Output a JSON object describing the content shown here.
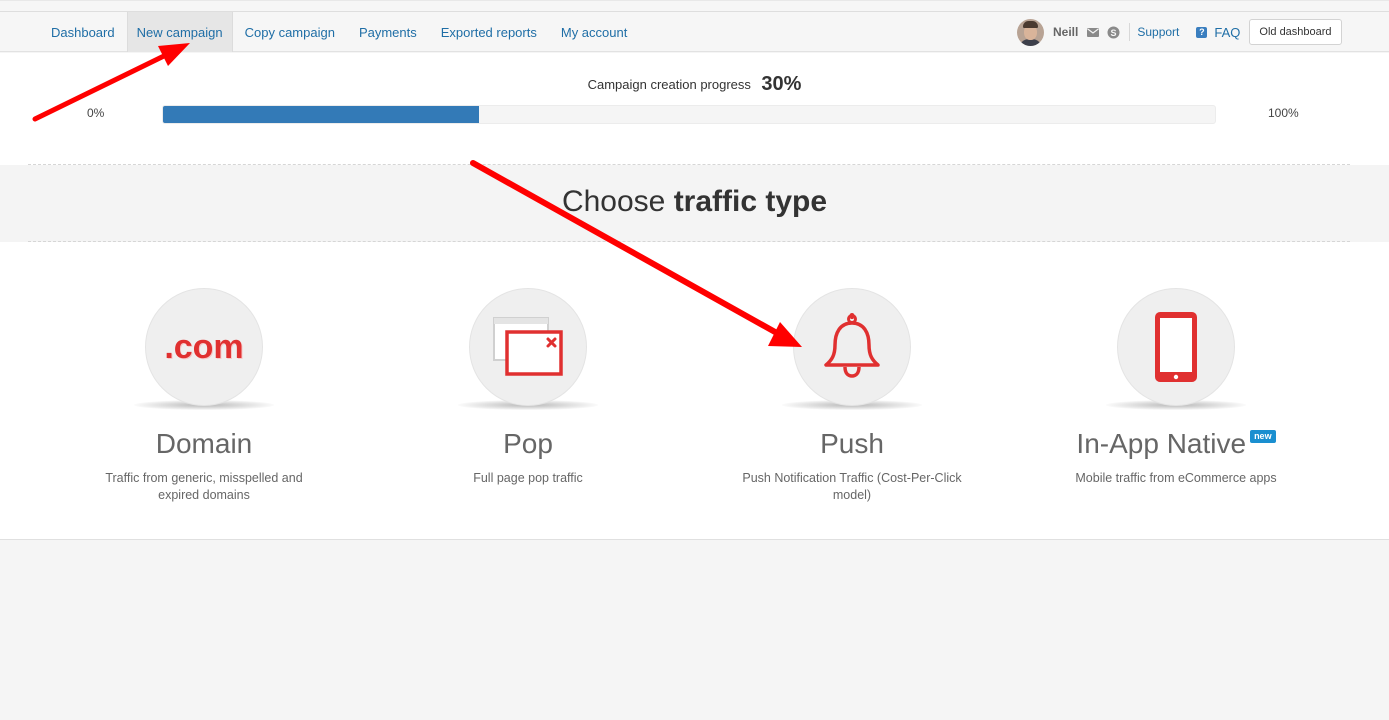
{
  "nav": {
    "items": [
      {
        "label": "Dashboard"
      },
      {
        "label": "New campaign"
      },
      {
        "label": "Copy campaign"
      },
      {
        "label": "Payments"
      },
      {
        "label": "Exported reports"
      },
      {
        "label": "My account"
      }
    ],
    "active_index": 1
  },
  "user": {
    "name": "Neill",
    "support_label": "Support",
    "faq_label": "FAQ",
    "faq_icon_glyph": "?",
    "old_dashboard_label": "Old dashboard"
  },
  "progress": {
    "label": "Campaign creation progress",
    "value_text": "30%",
    "value": 30,
    "min_label": "0%",
    "max_label": "100%"
  },
  "heading": {
    "normal": "Choose ",
    "bold": "traffic type"
  },
  "traffic_types": [
    {
      "title": "Domain",
      "description": "Traffic from generic, misspelled and expired domains",
      "icon": "domain-com-icon",
      "icon_text": ".com"
    },
    {
      "title": "Pop",
      "description": "Full page pop traffic",
      "icon": "popup-window-icon"
    },
    {
      "title": "Push",
      "description": "Push Notification Traffic (Cost-Per-Click model)",
      "icon": "bell-icon"
    },
    {
      "title": "In-App Native",
      "description": "Mobile traffic from eCommerce apps",
      "icon": "mobile-phone-icon",
      "badge": "new"
    }
  ],
  "colors": {
    "link": "#1f6ea6",
    "progress_fill": "#337ab7",
    "icon_red": "#e03030",
    "badge_blue": "#1a8fd0",
    "annotation_arrow": "#ff0000"
  }
}
